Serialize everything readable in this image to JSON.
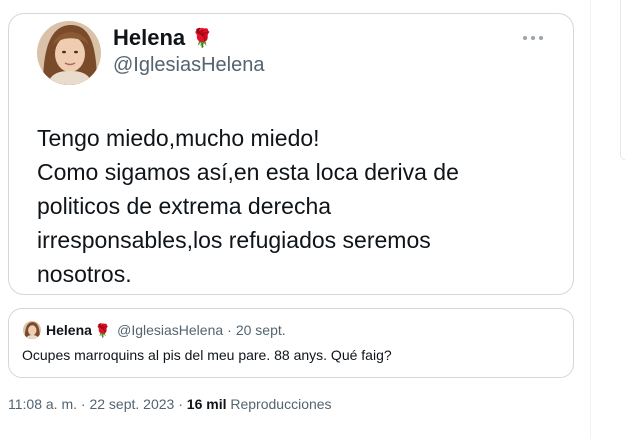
{
  "tweet": {
    "display_name": "Helena",
    "name_emoji": "🌹",
    "handle": "@IglesiasHelena",
    "text_lines": [
      "Tengo miedo,mucho miedo!",
      "Como sigamos así,en esta loca deriva de",
      "politicos de extrema derecha",
      "irresponsables,los refugiados seremos",
      "nosotros."
    ]
  },
  "quoted_tweet": {
    "display_name": "Helena",
    "name_emoji": "🌹",
    "handle": "@IglesiasHelena",
    "separator": "·",
    "date": "20 sept.",
    "text": "Ocupes marroquins al pis del meu pare. 88 anys. Qué faig?"
  },
  "meta": {
    "time": "11:08 a. m.",
    "separator": "·",
    "date": "22 sept. 2023",
    "separator2": "·",
    "views_count": "16 mil",
    "views_label": "Reproducciones"
  },
  "icons": {
    "more": "more-horizontal-icon",
    "rose": "rose-emoji-icon"
  },
  "colors": {
    "text_primary": "#0f1419",
    "text_secondary": "#536471",
    "border": "#cfd9de",
    "rose": "#c8102e"
  }
}
